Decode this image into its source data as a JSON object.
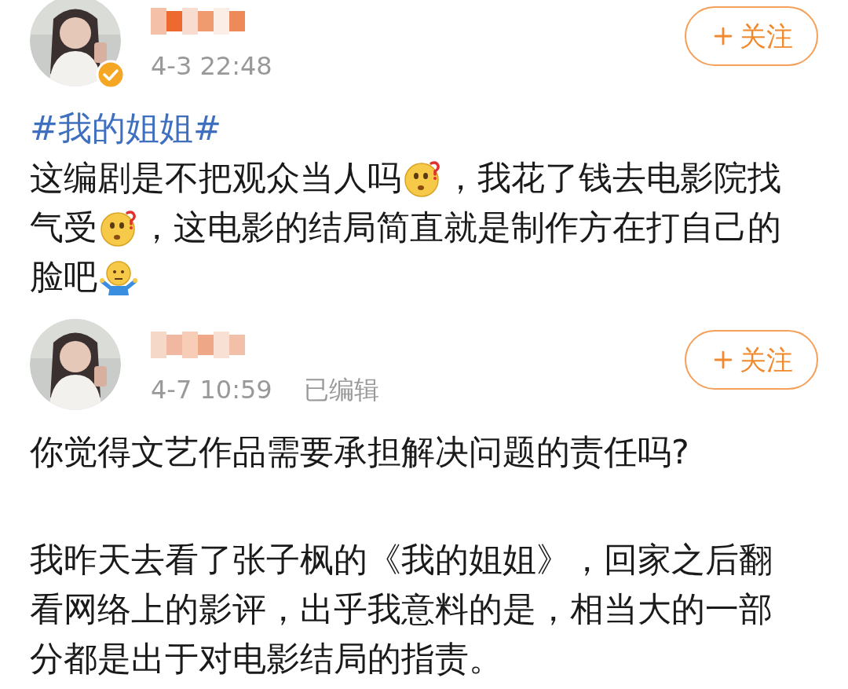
{
  "posts": [
    {
      "verified": true,
      "time": "4-3 22:48",
      "follow_button": {
        "label": "关注"
      },
      "paragraphs": [
        [
          [
            {
              "kind": "hashtag",
              "text": "#我的姐姐#"
            }
          ],
          [
            {
              "kind": "text",
              "text": "这编剧是不把观众当人吗"
            },
            {
              "kind": "puzzled_emoji"
            },
            {
              "kind": "text",
              "text": "，我花了钱去电影院找"
            }
          ],
          [
            {
              "kind": "text",
              "text": "气受"
            },
            {
              "kind": "puzzled_emoji"
            },
            {
              "kind": "text",
              "text": "，这电影的结局简直就是制作方在打自己的"
            }
          ],
          [
            {
              "kind": "text",
              "text": "脸吧"
            },
            {
              "kind": "shrug_emoji"
            }
          ]
        ]
      ]
    },
    {
      "time": "4-7 10:59",
      "edited": "已编辑",
      "follow_button": {
        "label": "关注"
      },
      "paragraphs": [
        [
          [
            {
              "kind": "text",
              "text": "你觉得文艺作品需要承担解决问题的责任吗?"
            }
          ]
        ],
        [
          [
            {
              "kind": "text",
              "text": "我昨天去看了张子枫的《我的姐姐》，回家之后翻"
            }
          ],
          [
            {
              "kind": "text",
              "text": "看网络上的影评，出乎我意料的是，相当大的一部"
            }
          ],
          [
            {
              "kind": "text",
              "text": "分都是出于对电影结局的指责。"
            }
          ]
        ]
      ]
    }
  ]
}
